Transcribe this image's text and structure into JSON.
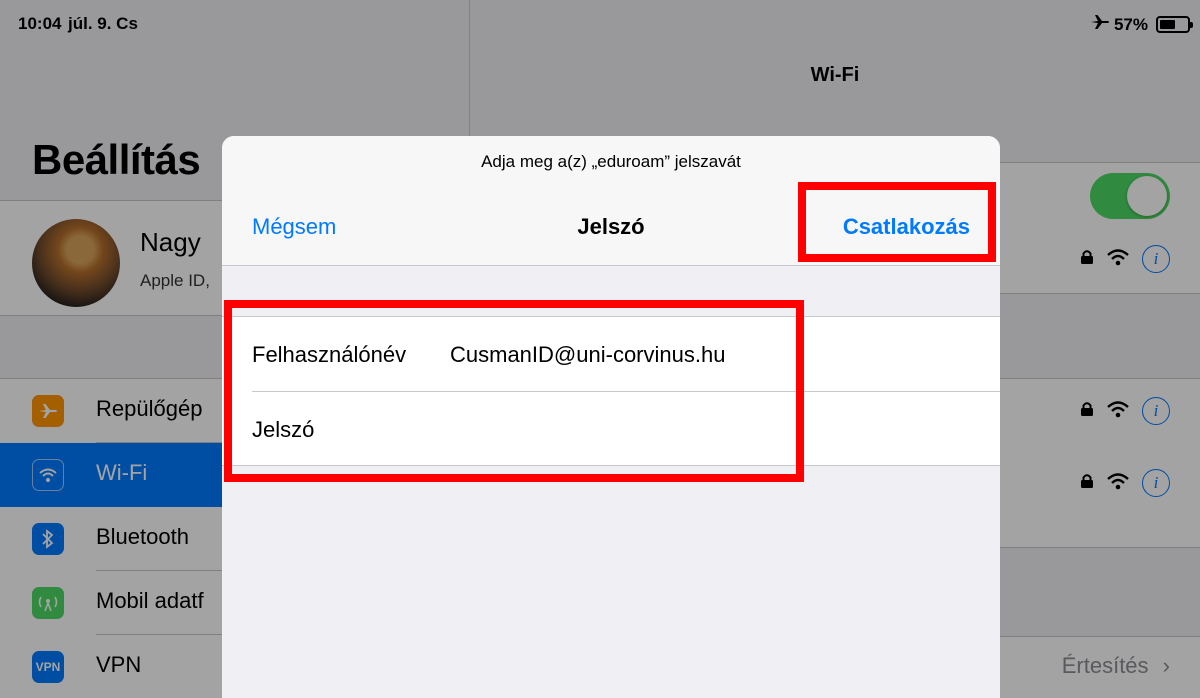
{
  "status": {
    "time": "10:04",
    "date": "júl. 9. Cs",
    "battery": "57%",
    "battery_level": 0.57,
    "airplane_icon": "airplane-icon"
  },
  "master": {
    "title": "Beállítás",
    "profile": {
      "name": "Nagy",
      "subtitle": "Apple ID,"
    },
    "items": [
      {
        "label": "Repülőgép",
        "icon": "airplane-icon",
        "color": "#ff9500",
        "glyph": "✈"
      },
      {
        "label": "Wi-Fi",
        "icon": "wifi-icon",
        "color": "#007aff",
        "glyph": "◠"
      },
      {
        "label": "Bluetooth",
        "icon": "bluetooth-icon",
        "color": "#007aff",
        "glyph": "✱"
      },
      {
        "label": "Mobil adatf",
        "icon": "cellular-icon",
        "color": "#4cd964",
        "glyph": "((·))"
      },
      {
        "label": "VPN",
        "icon": "vpn-icon",
        "color": "#007aff",
        "glyph": "VPN"
      }
    ]
  },
  "detail": {
    "nav_title": "Wi-Fi",
    "notifications_label": "Értesítés",
    "chevron": "›"
  },
  "modal": {
    "prompt": "Adja meg a(z) „eduroam” jelszavát",
    "cancel_label": "Mégsem",
    "title": "Jelszó",
    "join_label": "Csatlakozás",
    "username_label": "Felhasználónév",
    "username_value": "CusmanID@uni-corvinus.hu",
    "password_label": "Jelszó",
    "password_value": ""
  },
  "colors": {
    "accent": "#007aff",
    "toggle_on": "#4cd964",
    "annotation": "#ff0000"
  }
}
